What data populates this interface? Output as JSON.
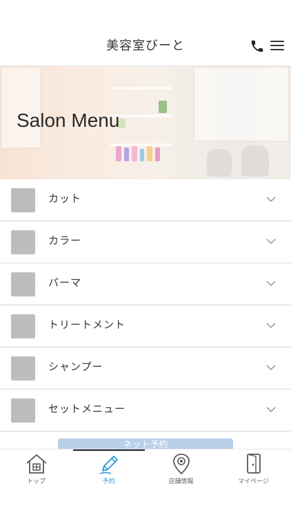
{
  "header": {
    "title": "美容室びーと"
  },
  "hero": {
    "title": "Salon Menu"
  },
  "menu": {
    "items": [
      {
        "label": "カット"
      },
      {
        "label": "カラー"
      },
      {
        "label": "パーマ"
      },
      {
        "label": "トリートメント"
      },
      {
        "label": "シャンプー"
      },
      {
        "label": "セットメニュー"
      }
    ]
  },
  "reserve_button": {
    "label": "ネット予約"
  },
  "tabbar": {
    "tabs": [
      {
        "label": "トップ",
        "icon": "home-icon"
      },
      {
        "label": "予約",
        "icon": "pencil-icon"
      },
      {
        "label": "店舗情報",
        "icon": "map-pin-icon"
      },
      {
        "label": "マイページ",
        "icon": "door-icon"
      }
    ],
    "active_color": "#2b95d6"
  }
}
